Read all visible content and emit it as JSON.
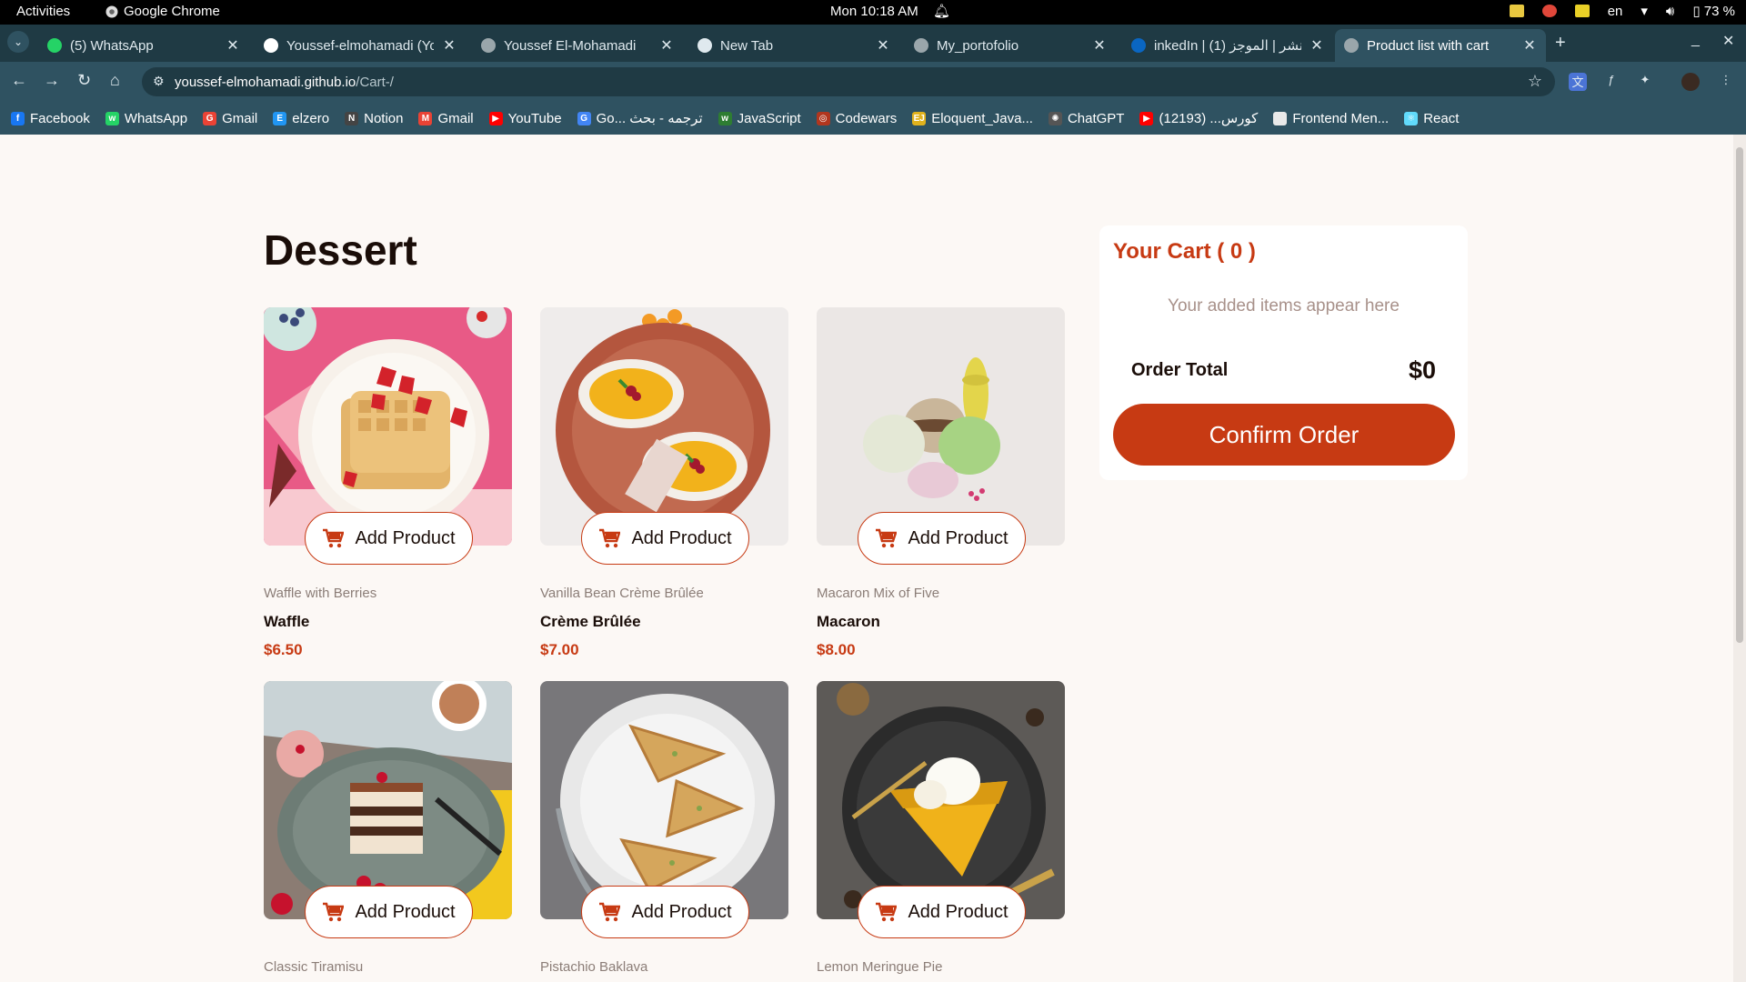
{
  "system": {
    "activities": "Activities",
    "app_name": "Google Chrome",
    "clock": "Mon 10:18 AM",
    "language": "en",
    "battery": "73 %"
  },
  "tabs": [
    {
      "title": "(5) WhatsApp",
      "favicon_color": "#25d366",
      "icon": "whatsapp-icon"
    },
    {
      "title": "Youssef-elmohamadi (Yo",
      "favicon_color": "#ffffff",
      "icon": "github-icon"
    },
    {
      "title": "Youssef El-Mohamadi",
      "favicon_color": "#9aa6ab",
      "icon": "globe-icon"
    },
    {
      "title": "New Tab",
      "favicon_color": "#dfe9ee",
      "icon": "chrome-icon"
    },
    {
      "title": "My_portofolio",
      "favicon_color": "#9aa6ab",
      "icon": "globe-icon"
    },
    {
      "title": "inkedIn | نشر | الموجز (1)",
      "favicon_color": "#0a66c2",
      "icon": "linkedin-icon"
    },
    {
      "title": "Product list with cart",
      "favicon_color": "#9aa6ab",
      "icon": "globe-icon",
      "active": true
    }
  ],
  "address": {
    "domain": "youssef-elmohamadi.github.io",
    "path": "/Cart-/"
  },
  "bookmarks": [
    {
      "label": "Facebook",
      "color": "#1877f2",
      "icon": "facebook-icon",
      "glyph": "f"
    },
    {
      "label": "WhatsApp",
      "color": "#25d366",
      "icon": "whatsapp-icon",
      "glyph": "w"
    },
    {
      "label": "Gmail",
      "color": "#ea4335",
      "icon": "google-icon",
      "glyph": "G"
    },
    {
      "label": "elzero",
      "color": "#2196f3",
      "icon": "elzero-icon",
      "glyph": "E"
    },
    {
      "label": "Notion",
      "color": "#444444",
      "icon": "notion-icon",
      "glyph": "N"
    },
    {
      "label": "Gmail",
      "color": "#ea4335",
      "icon": "gmail-icon",
      "glyph": "M"
    },
    {
      "label": "YouTube",
      "color": "#ff0000",
      "icon": "youtube-icon",
      "glyph": "▶"
    },
    {
      "label": "Go... ترجمه - بحث",
      "color": "#4285f4",
      "icon": "google-icon",
      "glyph": "G"
    },
    {
      "label": "JavaScript",
      "color": "#2e7d32",
      "icon": "javascript-icon",
      "glyph": "w"
    },
    {
      "label": "Codewars",
      "color": "#b1361e",
      "icon": "codewars-icon",
      "glyph": "◎"
    },
    {
      "label": "Eloquent_Java...",
      "color": "#e0b21d",
      "icon": "eloquent-icon",
      "glyph": "EJ"
    },
    {
      "label": "ChatGPT",
      "color": "#555555",
      "icon": "chatgpt-icon",
      "glyph": "✺"
    },
    {
      "label": "كورس... (12193)",
      "color": "#ff0000",
      "icon": "youtube-icon",
      "glyph": "▶"
    },
    {
      "label": "Frontend Men...",
      "color": "#e9e9e9",
      "icon": "frontend-mentor-icon",
      "glyph": ""
    },
    {
      "label": "React",
      "color": "#61dafb",
      "icon": "react-icon",
      "glyph": "⚛"
    }
  ],
  "page": {
    "heading": "Dessert",
    "add_label": "Add Product",
    "products": [
      {
        "category": "Waffle with Berries",
        "name": "Waffle",
        "price": "$6.50"
      },
      {
        "category": "Vanilla Bean Crème Brûlée",
        "name": "Crème Brûlée",
        "price": "$7.00"
      },
      {
        "category": "Macaron Mix of Five",
        "name": "Macaron",
        "price": "$8.00"
      },
      {
        "category": "Classic Tiramisu",
        "name": "",
        "price": ""
      },
      {
        "category": "Pistachio Baklava",
        "name": "",
        "price": ""
      },
      {
        "category": "Lemon Meringue Pie",
        "name": "",
        "price": ""
      }
    ]
  },
  "cart": {
    "title": "Your Cart ( 0 )",
    "empty": "Your added items appear here",
    "total_label": "Order Total",
    "total_value": "$0",
    "confirm": "Confirm Order"
  },
  "colors": {
    "accent": "#c73a13",
    "page_bg": "#fcf8f5",
    "chrome_frame": "#1f3a44",
    "chrome_toolbar": "#2f5261"
  }
}
